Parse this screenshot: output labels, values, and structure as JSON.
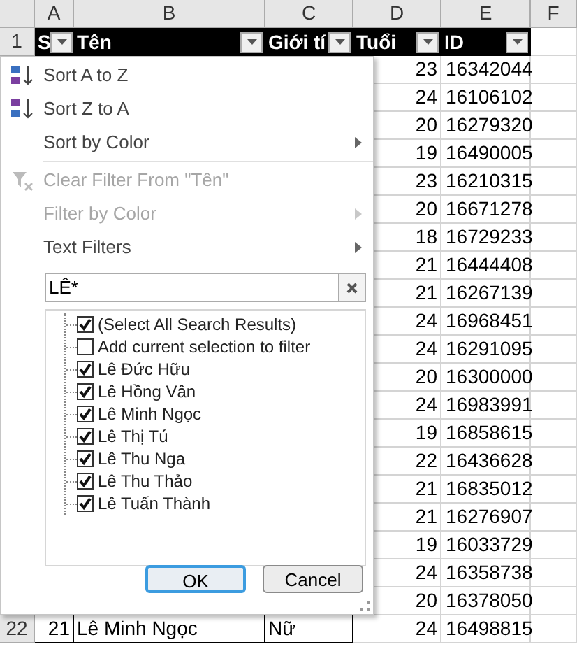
{
  "columns": [
    "A",
    "B",
    "C",
    "D",
    "E",
    "F"
  ],
  "header_row": {
    "number": "1",
    "cells": [
      "S",
      "Tên",
      "Giới tí",
      "Tuổi",
      "ID"
    ]
  },
  "rows": [
    {
      "tuoi": "23",
      "id": "16342044"
    },
    {
      "tuoi": "24",
      "id": "16106102"
    },
    {
      "tuoi": "20",
      "id": "16279320"
    },
    {
      "tuoi": "19",
      "id": "16490005"
    },
    {
      "tuoi": "23",
      "id": "16210315"
    },
    {
      "tuoi": "20",
      "id": "16671278"
    },
    {
      "tuoi": "18",
      "id": "16729233"
    },
    {
      "tuoi": "21",
      "id": "16444408"
    },
    {
      "tuoi": "21",
      "id": "16267139"
    },
    {
      "tuoi": "24",
      "id": "16968451"
    },
    {
      "tuoi": "24",
      "id": "16291095"
    },
    {
      "tuoi": "20",
      "id": "16300000"
    },
    {
      "tuoi": "24",
      "id": "16983991"
    },
    {
      "tuoi": "19",
      "id": "16858615"
    },
    {
      "tuoi": "22",
      "id": "16436628"
    },
    {
      "tuoi": "21",
      "id": "16835012"
    },
    {
      "tuoi": "21",
      "id": "16276907"
    },
    {
      "tuoi": "19",
      "id": "16033729"
    },
    {
      "tuoi": "24",
      "id": "16358738"
    },
    {
      "tuoi": "20",
      "id": "16378050"
    },
    {
      "number": "22",
      "stt": "21",
      "ten": "Lê Minh Ngọc",
      "gioi_tinh": "Nữ",
      "tuoi": "24",
      "id": "16498815"
    }
  ],
  "filter_menu": {
    "items": [
      {
        "kind": "sort_az",
        "label": "Sort A to Z",
        "disabled": false,
        "submenu": false
      },
      {
        "kind": "sort_za",
        "label": "Sort Z to A",
        "disabled": false,
        "submenu": false
      },
      {
        "kind": "plain",
        "label": "Sort by Color",
        "disabled": false,
        "submenu": true
      },
      {
        "kind": "separator"
      },
      {
        "kind": "clear",
        "label": "Clear Filter From \"Tên\"",
        "disabled": true,
        "submenu": false
      },
      {
        "kind": "plain",
        "label": "Filter by Color",
        "disabled": true,
        "submenu": true
      },
      {
        "kind": "plain",
        "label": "Text Filters",
        "disabled": false,
        "submenu": true
      }
    ],
    "search": {
      "value": "LÊ*"
    },
    "options": [
      {
        "label": "(Select All Search Results)",
        "checked": true
      },
      {
        "label": "Add current selection to filter",
        "checked": false
      },
      {
        "label": "Lê Đức Hữu",
        "checked": true
      },
      {
        "label": "Lê Hồng Vân",
        "checked": true
      },
      {
        "label": "Lê Minh Ngọc",
        "checked": true
      },
      {
        "label": "Lê Thị Tú",
        "checked": true
      },
      {
        "label": "Lê Thu Nga",
        "checked": true
      },
      {
        "label": "Lê Thu Thảo",
        "checked": true
      },
      {
        "label": "Lê Tuấn Thành",
        "checked": true
      }
    ],
    "buttons": [
      "OK",
      "Cancel"
    ]
  }
}
